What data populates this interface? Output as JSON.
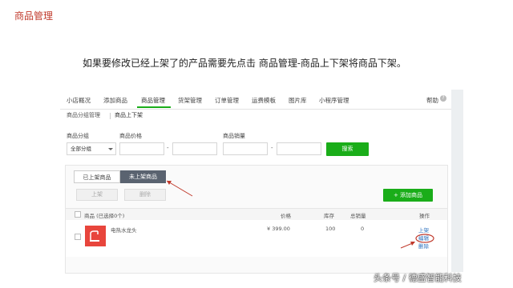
{
  "slide": {
    "title": "商品管理",
    "instruction": "如果要修改已经上架了的产品需要先点击 商品管理-商品上下架将商品下架。"
  },
  "topnav": {
    "items": [
      "小店概况",
      "添加商品",
      "商品管理",
      "货架管理",
      "订单管理",
      "运费模板",
      "图片库",
      "小程序管理"
    ],
    "active": "商品管理",
    "help": "帮助"
  },
  "subnav": {
    "items": [
      "商品分组管理",
      "商品上下架"
    ]
  },
  "filters": {
    "group_label": "商品分组",
    "group_value": "全部分组",
    "price_label": "商品价格",
    "sales_label": "商品销量",
    "range_sep": "-",
    "search_label": "搜索"
  },
  "list": {
    "tabs": [
      "已上架商品",
      "未上架商品"
    ],
    "active_tab": "未上架商品",
    "actions": [
      "上架",
      "删除"
    ],
    "add_label": "添加商品",
    "headers": {
      "product": "商品 (已选择0个)",
      "price": "价格",
      "stock": "库存",
      "sales": "总销量",
      "ops": "操作"
    },
    "rows": [
      {
        "name": "电热水龙头",
        "price": "¥ 399.00",
        "stock": "100",
        "sales": "0",
        "ops": [
          "上架",
          "编辑",
          "删除"
        ]
      }
    ]
  },
  "colors": {
    "accent_green": "#1aad19",
    "dark_tab": "#5a6370",
    "annotation_red": "#c0392b",
    "link_blue": "#2a6fbd"
  },
  "watermark": "头条号 / 德盛智能科技"
}
